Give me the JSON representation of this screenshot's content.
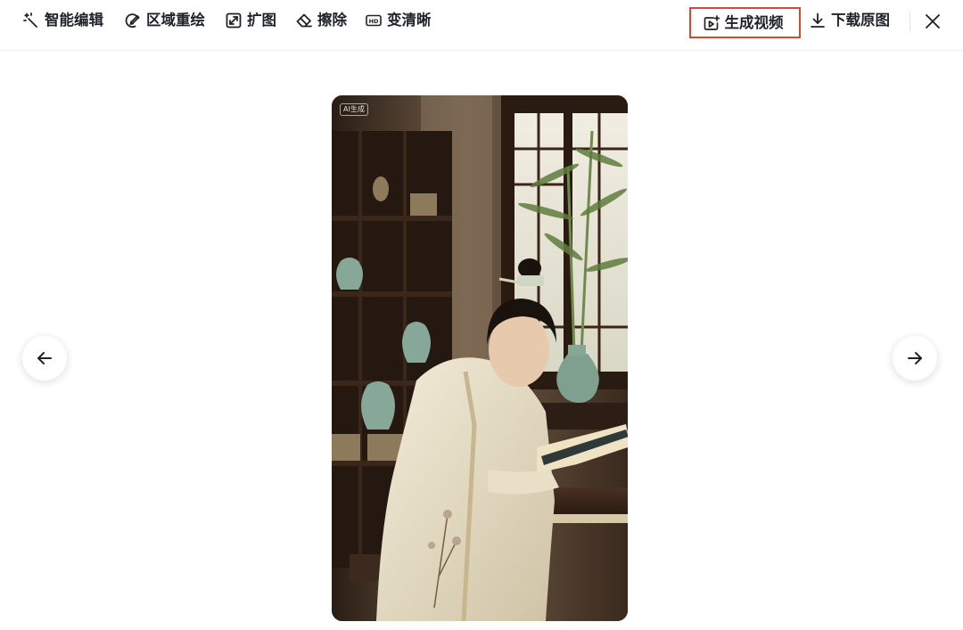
{
  "toolbar": {
    "tools": [
      {
        "label": "智能编辑",
        "icon": "magic-wand-icon"
      },
      {
        "label": "区域重绘",
        "icon": "brush-circle-icon"
      },
      {
        "label": "扩图",
        "icon": "expand-icon"
      },
      {
        "label": "擦除",
        "icon": "eraser-icon"
      },
      {
        "label": "变清晰",
        "icon": "hd-icon"
      }
    ],
    "generate_video": {
      "label": "生成视频",
      "icon": "video-sparkle-icon"
    },
    "download": {
      "label": "下载原图",
      "icon": "download-icon"
    },
    "close": {
      "icon": "close-icon"
    }
  },
  "viewer": {
    "prev": {
      "icon": "arrow-left-icon"
    },
    "next": {
      "icon": "arrow-right-icon"
    },
    "image": {
      "badge": "AI生成",
      "subject": "young man in white hanfu reading a book at a wooden desk in a study with vases and bamboo"
    }
  },
  "colors": {
    "highlight_border": "#e0452d",
    "text": "#1f2329"
  }
}
